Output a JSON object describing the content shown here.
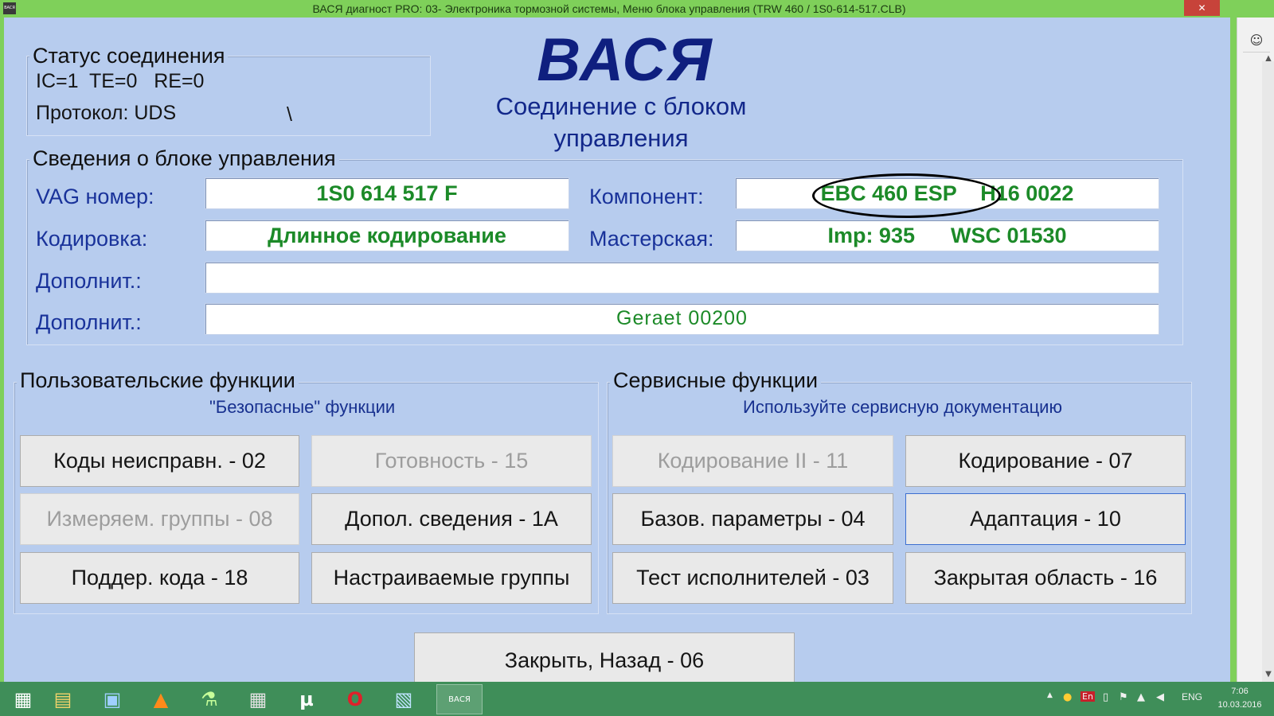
{
  "titlebar": {
    "app_icon": "ВАСЯ",
    "title": "ВАСЯ диагност PRO: 03- Электроника тормозной системы,  Меню блока управления (TRW 460 / 1S0-614-517.CLB)",
    "close_icon": "✕"
  },
  "status": {
    "title": "Статус соединения",
    "line1": "IC=1  TE=0   RE=0",
    "protocol": "Протокол: UDS",
    "spinner": "\\"
  },
  "logo": "ВАСЯ",
  "subtitle_line1": "Соединение с блоком",
  "subtitle_line2": "управления",
  "info": {
    "title": "Сведения о блоке управления",
    "vag_label": "VAG номер:",
    "vag_value": "1S0 614 517 F",
    "component_label": "Компонент:",
    "component_value": "EBC 460 ESP    H16 0022",
    "coding_label": "Кодировка:",
    "coding_value": "Длинное кодирование",
    "shop_label": "Мастерская:",
    "shop_value": "Imp: 935      WSC 01530",
    "extra1_label": "Дополнит.:",
    "extra1_value": "",
    "extra2_label": "Дополнит.:",
    "extra2_value": "Geraet 00200"
  },
  "user_functions": {
    "title": "Пользовательские функции",
    "note": "\"Безопасные\" функции",
    "buttons": [
      {
        "label": "Коды неисправн. - 02",
        "enabled": true
      },
      {
        "label": "Готовность - 15",
        "enabled": false
      },
      {
        "label": "Измеряем. группы - 08",
        "enabled": false
      },
      {
        "label": "Допол. сведения - 1А",
        "enabled": true
      },
      {
        "label": "Поддер. кода - 18",
        "enabled": true
      },
      {
        "label": "Настраиваемые группы",
        "enabled": true
      }
    ]
  },
  "service_functions": {
    "title": "Сервисные функции",
    "note": "Используйте сервисную документацию",
    "buttons": [
      {
        "label": "Кодирование II - 11",
        "enabled": false
      },
      {
        "label": "Кодирование - 07",
        "enabled": true
      },
      {
        "label": "Базов. параметры - 04",
        "enabled": true
      },
      {
        "label": "Адаптация - 10",
        "enabled": true
      },
      {
        "label": "Тест исполнителей - 03",
        "enabled": true
      },
      {
        "label": "Закрытая область - 16",
        "enabled": true
      }
    ]
  },
  "close_button": "Закрыть, Назад - 06",
  "right_panel": {
    "user_icon": "☺",
    "scroll_up": "▲",
    "scroll_down": "▼"
  },
  "taskbar": {
    "start_icon": "▦",
    "explorer_icon": "▤",
    "control_icon": "▣",
    "vlc_icon": "▲",
    "tool_icon": "⚗",
    "calc_icon": "▦",
    "utorrent_icon": "µ",
    "opera_icon": "O",
    "image_icon": "▧",
    "vasya_icon": "ВАСЯ",
    "tray_up": "▲",
    "tray_lang_box": "En",
    "lang": "ENG",
    "time": "7:06",
    "date": "10.03.2016"
  }
}
